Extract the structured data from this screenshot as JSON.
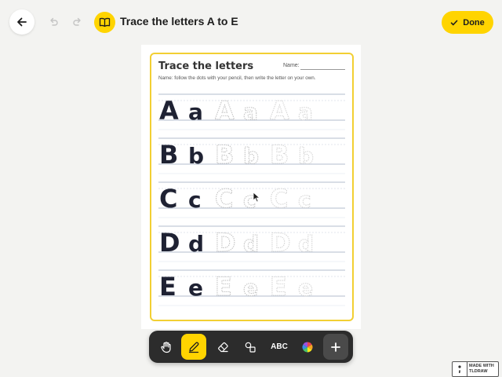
{
  "header": {
    "title": "Trace the letters A to E",
    "back_icon": "arrow-left-icon",
    "undo_icon": "undo-icon",
    "redo_icon": "redo-icon",
    "book_icon": "book-icon",
    "done_label": "Done",
    "done_icon": "check-icon"
  },
  "worksheet": {
    "title": "Trace the letters",
    "name_label": "Name:",
    "instructions": "Name: follow the dots with your pencil, then write the letter on your own.",
    "rows": [
      {
        "upper": "A",
        "lower": "a"
      },
      {
        "upper": "B",
        "lower": "b"
      },
      {
        "upper": "C",
        "lower": "c"
      },
      {
        "upper": "D",
        "lower": "d"
      },
      {
        "upper": "E",
        "lower": "e"
      }
    ],
    "border_color": "#f2cf33"
  },
  "toolbar": {
    "tools": [
      {
        "name": "hand",
        "icon": "hand-icon",
        "selected": false
      },
      {
        "name": "pencil",
        "icon": "pencil-icon",
        "selected": true
      },
      {
        "name": "eraser",
        "icon": "eraser-icon",
        "selected": false
      },
      {
        "name": "shapes",
        "icon": "shapes-icon",
        "selected": false
      },
      {
        "name": "text",
        "label": "ABC",
        "selected": false
      },
      {
        "name": "color",
        "icon": "color-wheel-icon",
        "selected": false
      },
      {
        "name": "add",
        "icon": "plus-icon",
        "selected": false
      }
    ],
    "text_label": "ABC",
    "accent": "#ffd400"
  },
  "badge": {
    "line1": "MADE WITH",
    "line2": "TLDRAW"
  }
}
